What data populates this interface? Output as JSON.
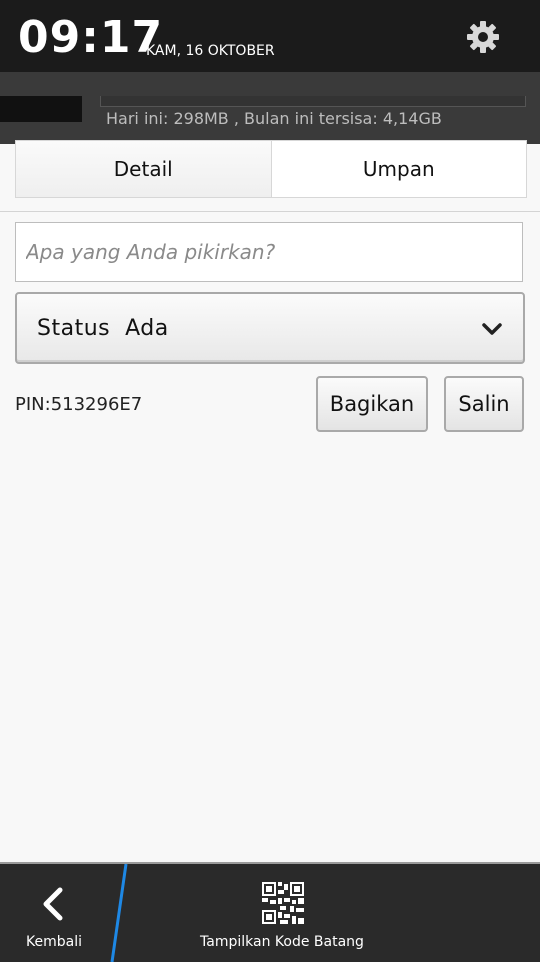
{
  "status_bar": {
    "time": "09:17",
    "date": "KAM, 16 OKTOBER",
    "settings_icon": "gear-icon"
  },
  "notification": {
    "usage_text": "Hari ini: 298MB , Bulan ini tersisa: 4,14GB"
  },
  "tabs": [
    {
      "label": "Detail",
      "active": true
    },
    {
      "label": "Umpan",
      "active": false
    }
  ],
  "status_input": {
    "value": "",
    "placeholder": "Apa yang Anda pikirkan?"
  },
  "status_dropdown": {
    "selected": "Status  Ada",
    "icon": "chevron-down-icon"
  },
  "pin": {
    "text": "PIN:513296E7",
    "share_label": "Bagikan",
    "copy_label": "Salin"
  },
  "action_bar": {
    "back_label": "Kembali",
    "back_icon": "back-arrow-icon",
    "barcode_label": "Tampilkan Kode Batang",
    "barcode_icon": "qr-code-icon"
  },
  "colors": {
    "status_bar_bg": "#1b1b1b",
    "action_bar_bg": "#2a2a2a",
    "accent_separator": "#1e88e5"
  }
}
